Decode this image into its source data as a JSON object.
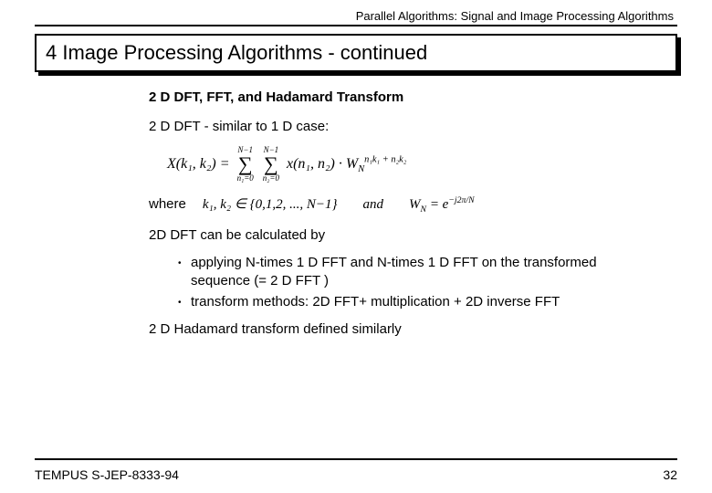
{
  "header": "Parallel Algorithms:  Signal and Image Processing Algorithms",
  "title": "4 Image Processing Algorithms - continued",
  "section_title": "2 D DFT, FFT, and Hadamard Transform",
  "intro": "2 D DFT - similar to 1 D case:",
  "formula": {
    "lhs": "X(k₁, k₂) =",
    "sum1_top": "N−1",
    "sum1_bot": "n₁=0",
    "sum2_top": "N−1",
    "sum2_bot": "n₂=0",
    "body": "x(n₁, n₂) · W",
    "exp": "n₁k₁ + n₂k₂",
    "expsub": "N"
  },
  "where_label": "where",
  "where_set": "k₁, k₂ ∈ {0,1,2, ..., N−1}",
  "where_and": "and",
  "where_wn": "W",
  "where_wn_sub": "N",
  "where_wn_eq": " = e",
  "where_wn_exp": "−j2π/N",
  "calc_intro": "2D DFT can be calculated by",
  "bullets": [
    "applying N-times 1 D FFT and N-times 1 D FFT on the transformed sequence (= 2 D FFT )",
    "transform methods: 2D FFT+ multiplication + 2D inverse FFT"
  ],
  "hadamard": "2 D Hadamard transform defined similarly",
  "footer_left": "TEMPUS S-JEP-8333-94",
  "footer_right": "32"
}
